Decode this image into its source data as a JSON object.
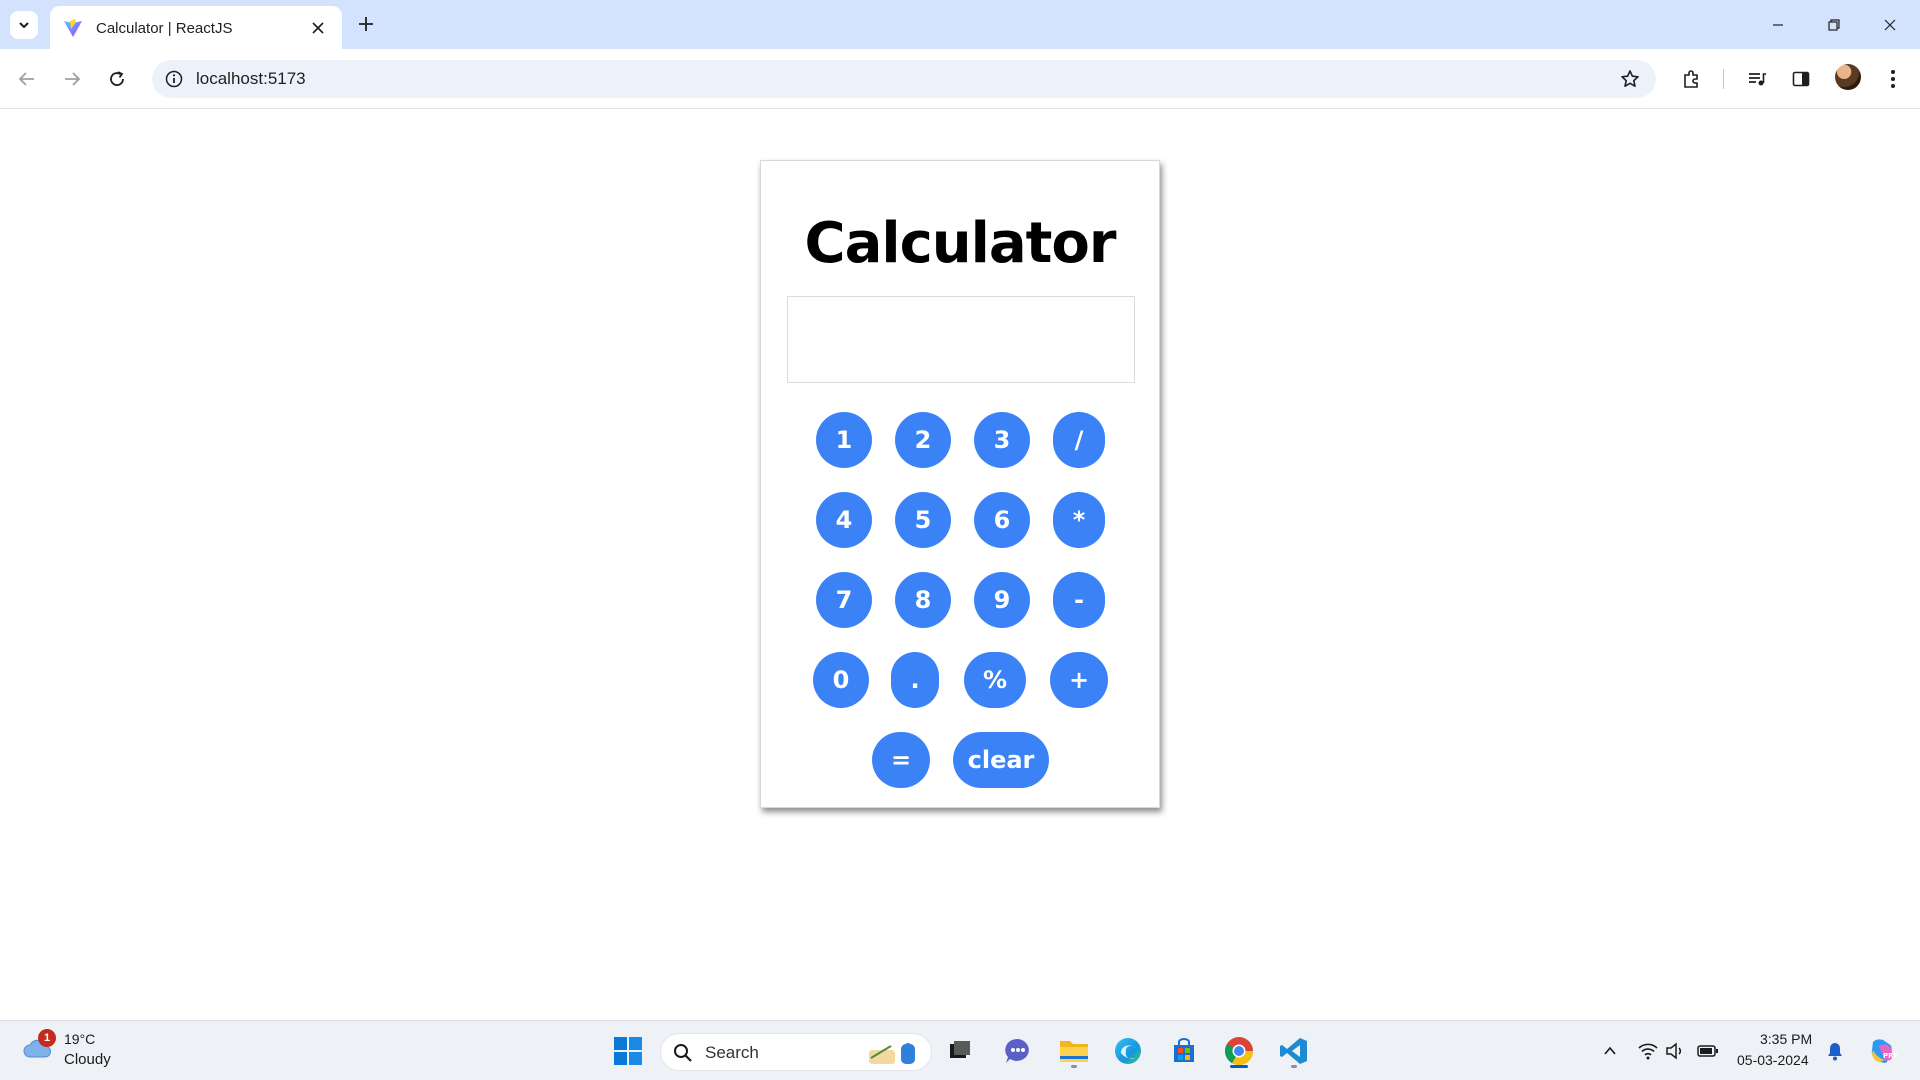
{
  "browser": {
    "tab_title": "Calculator | ReactJS",
    "url": "localhost:5173"
  },
  "calculator": {
    "title": "Calculator",
    "display_value": "",
    "keys": {
      "k1": "1",
      "k2": "2",
      "k3": "3",
      "div": "/",
      "k4": "4",
      "k5": "5",
      "k6": "6",
      "mul": "*",
      "k7": "7",
      "k8": "8",
      "k9": "9",
      "sub": "-",
      "k0": "0",
      "dot": ".",
      "pct": "%",
      "add": "+",
      "eq": "=",
      "clear": "clear"
    },
    "accent_color": "#3b82f6"
  },
  "taskbar": {
    "weather_badge": "1",
    "weather_temp": "19°C",
    "weather_condition": "Cloudy",
    "search_label": "Search",
    "apps": [
      "start-icon",
      "search-icon",
      "task-view-icon",
      "chat-icon",
      "file-explorer-icon",
      "edge-icon",
      "store-icon",
      "chrome-icon",
      "vscode-icon"
    ],
    "time": "3:35 PM",
    "date": "05-03-2024"
  }
}
